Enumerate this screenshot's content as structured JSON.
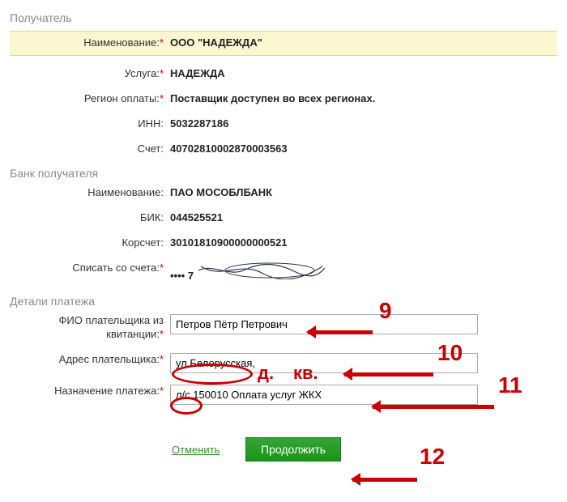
{
  "sections": {
    "recipient": "Получатель",
    "bank": "Банк получателя",
    "details": "Детали платежа"
  },
  "recipient": {
    "name_label": "Наименование:",
    "name_value": "ООО \"НАДЕЖДА\"",
    "service_label": "Услуга:",
    "service_value": "НАДЕЖДА",
    "region_label": "Регион оплаты:",
    "region_value": "Поставщик доступен во всех регионах.",
    "inn_label": "ИНН:",
    "inn_value": "5032287186",
    "account_label": "Счет:",
    "account_value": "40702810002870003563"
  },
  "bank": {
    "name_label": "Наименование:",
    "name_value": "ПАО МОСОБЛБАНК",
    "bik_label": "БИК:",
    "bik_value": "044525521",
    "corr_label": "Корсчет:",
    "corr_value": "30101810900000000521",
    "debit_label": "Списать со счета:",
    "debit_value": "•••• 7"
  },
  "details": {
    "fio_label": "ФИО плательщика из квитанции:",
    "fio_value": "Петров Пётр Петрович",
    "addr_label": "Адрес плательщика:",
    "addr_value": "ул.Белорусская,",
    "purpose_label": "Назначение платежа:",
    "purpose_value": "л/с 150010 Оплата услуг ЖКХ"
  },
  "actions": {
    "cancel": "Отменить",
    "continue": "Продолжить"
  },
  "annotations": {
    "n9": "9",
    "n10": "10",
    "n11": "11",
    "n12": "12",
    "d": "д.",
    "kv": "кв."
  }
}
